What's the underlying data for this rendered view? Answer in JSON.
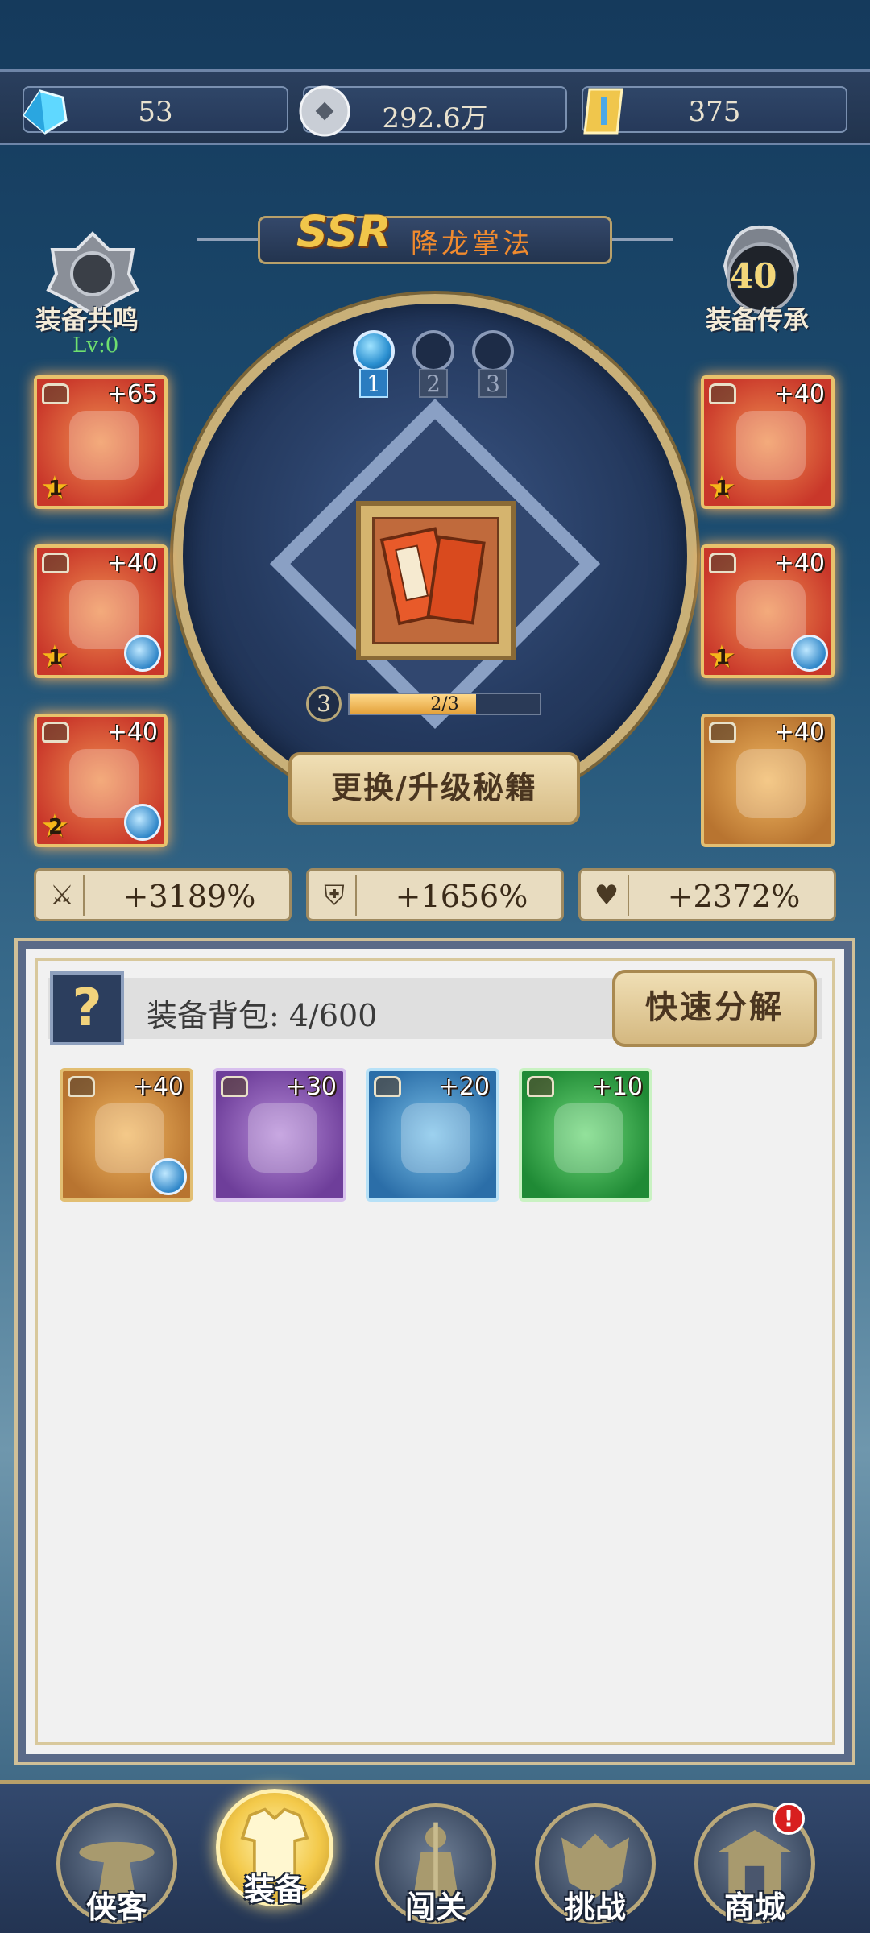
{
  "currency": {
    "jade": "53",
    "coin": "292.6万",
    "token": "375"
  },
  "header": {
    "rarity": "SSR",
    "skill_name": "降龙掌法",
    "resonance_label": "装备共鸣",
    "resonance_level": "Lv:0",
    "inherit_label": "装备传承",
    "inherit_level": "40"
  },
  "slots": [
    "1",
    "2",
    "3"
  ],
  "progress": {
    "level": "3",
    "text": "2/3",
    "fraction": 0.667
  },
  "upgrade_label": "更换/升级秘籍",
  "equipment_left": [
    {
      "plus": "+65",
      "star": "1",
      "orb": false
    },
    {
      "plus": "+40",
      "star": "1",
      "orb": true
    },
    {
      "plus": "+40",
      "star": "2",
      "orb": true
    }
  ],
  "equipment_right": [
    {
      "plus": "+40",
      "star": "1",
      "orb": false
    },
    {
      "plus": "+40",
      "star": "1",
      "orb": true
    },
    {
      "plus": "+40",
      "star": "",
      "orb": false
    }
  ],
  "stats": {
    "attack": "+3189%",
    "defense": "+1656%",
    "health": "+2372%"
  },
  "bag": {
    "label": "装备背包: 4/600",
    "help": "?",
    "quick_decompose": "快速分解",
    "items": [
      {
        "plus": "+40"
      },
      {
        "plus": "+30"
      },
      {
        "plus": "+20"
      },
      {
        "plus": "+10"
      }
    ]
  },
  "nav": {
    "heroes": "侠客",
    "equipment": "装备",
    "stages": "闯关",
    "challenge": "挑战",
    "shop": "商城",
    "shop_badge": "!"
  }
}
